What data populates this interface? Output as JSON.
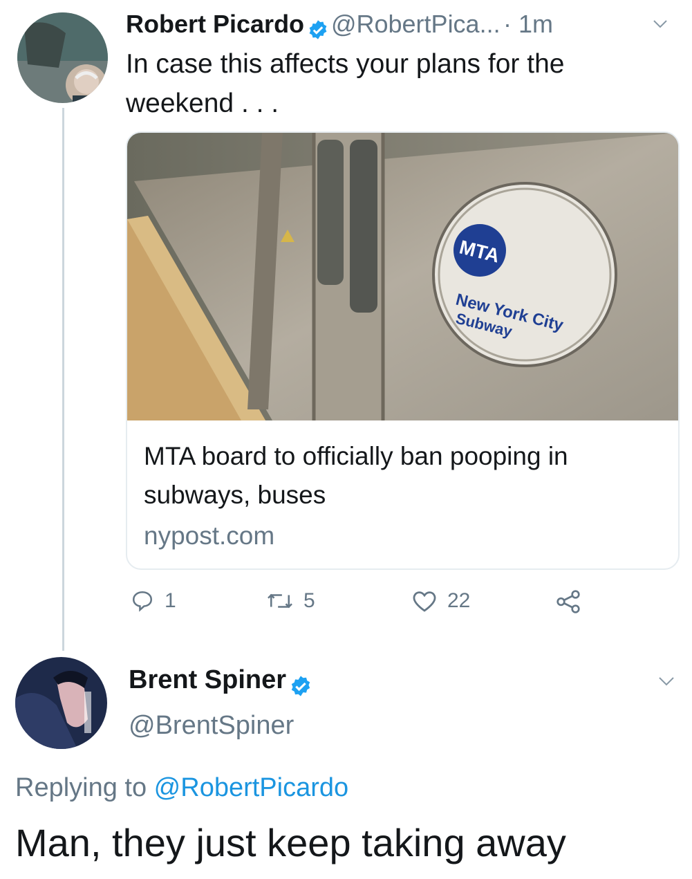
{
  "tweet": {
    "author_name": "Robert Picardo",
    "author_handle": "@RobertPica...",
    "time": "· 1m",
    "text_line1": "In case this affects your plans for the",
    "text_line2": "weekend . . .",
    "card": {
      "image_sign_logo": "MTA",
      "image_sign_line1": "New York City",
      "image_sign_line2": "Subway",
      "title_line1": "MTA board to officially ban pooping in",
      "title_line2": "subways, buses",
      "domain": "nypost.com"
    },
    "actions": {
      "replies": "1",
      "retweets": "5",
      "likes": "22"
    }
  },
  "reply": {
    "author_name": "Brent Spiner",
    "author_handle": "@BrentSpiner",
    "replying_prefix": "Replying to ",
    "replying_handle": "@RobertPicardo",
    "text": "Man, they just keep taking away"
  },
  "colors": {
    "verified": "#1da1f2",
    "link": "#1b95e0",
    "muted": "#657786"
  },
  "icons": [
    "chevron-down-icon",
    "verified-badge-icon",
    "reply-icon",
    "retweet-icon",
    "like-icon",
    "share-icon"
  ]
}
